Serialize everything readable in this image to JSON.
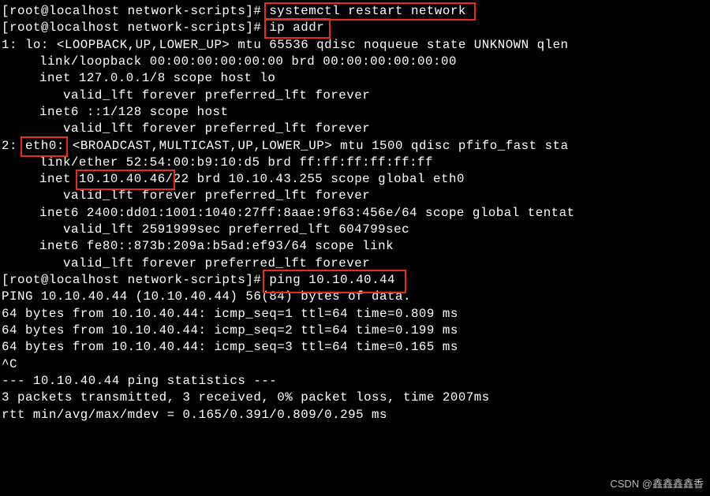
{
  "prompt": "[root@localhost network-scripts]#",
  "cmd": {
    "restart": "systemctl restart network",
    "ipaddr": "ip addr",
    "ping": "ping 10.10.40.44"
  },
  "iface": {
    "lo": {
      "header": "1: lo: <LOOPBACK,UP,LOWER_UP> mtu 65536 qdisc noqueue state UNKNOWN qlen",
      "link": "link/loopback 00:00:00:00:00:00 brd 00:00:00:00:00:00",
      "inet": "inet 127.0.0.1/8 scope host lo",
      "valid1": "valid_lft forever preferred_lft forever",
      "inet6": "inet6 ::1/128 scope host",
      "valid2": "valid_lft forever preferred_lft forever"
    },
    "eth0": {
      "num": "2:",
      "name": "eth0:",
      "header_rest": " <BROADCAST,MULTICAST,UP,LOWER_UP> mtu 1500 qdisc pfifo_fast sta",
      "link": "link/ether 52:54:00:b9:10:d5 brd ff:ff:ff:ff:ff:ff",
      "inet_pre": "inet ",
      "inet_ip": "10.10.40.46/",
      "inet_rest": "22 brd 10.10.43.255 scope global eth0",
      "valid1": "valid_lft forever preferred_lft forever",
      "inet6a": "inet6 2400:dd01:1001:1040:27ff:8aae:9f63:456e/64 scope global tentat",
      "valid2": "valid_lft 2591999sec preferred_lft 604799sec",
      "inet6b": "inet6 fe80::873b:209a:b5ad:ef93/64 scope link",
      "valid3": "valid_lft forever preferred_lft forever"
    }
  },
  "ping": {
    "header": "PING 10.10.40.44 (10.10.40.44) 56(84) bytes of data.",
    "r1": "64 bytes from 10.10.40.44: icmp_seq=1 ttl=64 time=0.809 ms",
    "r2": "64 bytes from 10.10.40.44: icmp_seq=2 ttl=64 time=0.199 ms",
    "r3": "64 bytes from 10.10.40.44: icmp_seq=3 ttl=64 time=0.165 ms",
    "ctrl": "^C",
    "stats_hdr": "--- 10.10.40.44 ping statistics ---",
    "stats_1": "3 packets transmitted, 3 received, 0% packet loss, time 2007ms",
    "stats_2": "rtt min/avg/max/mdev = 0.165/0.391/0.809/0.295 ms"
  },
  "watermark": "CSDN @鑫鑫鑫鑫香"
}
